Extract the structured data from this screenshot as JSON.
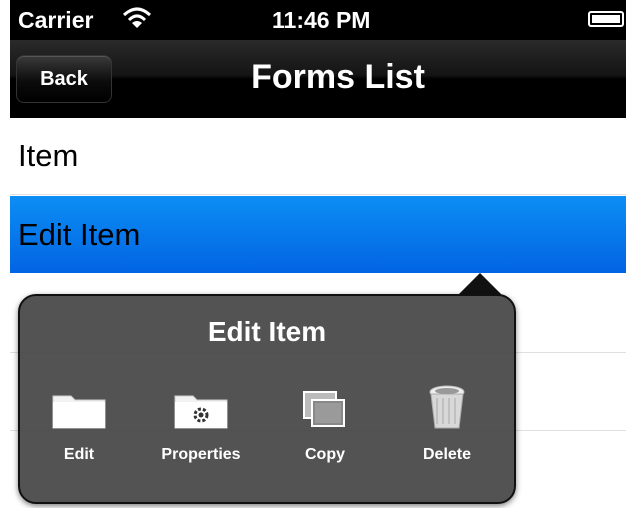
{
  "status_bar": {
    "carrier": "Carrier",
    "time": "11:46 PM",
    "wifi_icon": "wifi-icon",
    "battery_icon": "battery-icon"
  },
  "nav_bar": {
    "back_label": "Back",
    "title": "Forms List"
  },
  "list": {
    "rows": [
      {
        "label": "Item",
        "selected": false
      },
      {
        "label": "Edit Item",
        "selected": true
      }
    ]
  },
  "popover": {
    "title": "Edit Item",
    "actions": [
      {
        "label": "Edit",
        "icon": "folder-icon"
      },
      {
        "label": "Properties",
        "icon": "folder-gear-icon"
      },
      {
        "label": "Copy",
        "icon": "copy-icon"
      },
      {
        "label": "Delete",
        "icon": "trash-icon"
      }
    ]
  },
  "colors": {
    "selection_blue": "#0a7af0",
    "popover_bg": "#464646",
    "bar_black": "#000000"
  }
}
